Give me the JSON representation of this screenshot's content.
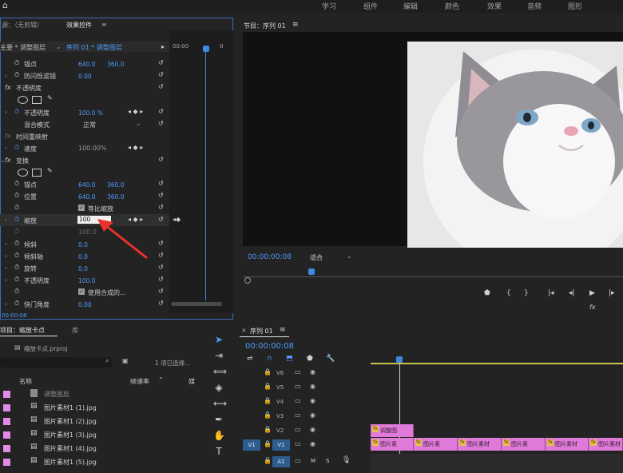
{
  "menu": {
    "items": [
      "学习",
      "组件",
      "编辑",
      "颜色",
      "效果",
      "音频",
      "图形"
    ]
  },
  "effect_controls": {
    "tab_source": "源：（无剪辑）",
    "tab_effect": "效果控件",
    "tab_effect_menu": "≡",
    "master": "主要 * 调整图层",
    "clip": "序列 01 * 调整图层",
    "timecode_left": "00:00",
    "timecode_right": "0",
    "current_time": "00:00:08",
    "rows": {
      "anchor_label": "锚点",
      "anchor_x": "640.0",
      "anchor_y": "360.0",
      "flicker_label": "防闪烁滤镜",
      "flicker_val": "0.00",
      "opacity_section": "不透明度",
      "opacity_label": "不透明度",
      "opacity_val": "100.0 %",
      "blend_label": "混合模式",
      "blend_val": "正常",
      "time_remap": "时间重映射",
      "speed_label": "速度",
      "speed_val": "100.00%",
      "transform_section": "变换",
      "t_anchor_label": "锚点",
      "t_anchor_x": "640.0",
      "t_anchor_y": "360.0",
      "pos_label": "位置",
      "pos_x": "640.0",
      "pos_y": "360.0",
      "uniform_label": "等比缩放",
      "scale_label": "缩放",
      "scale_val": "100",
      "scale_w_val": "100.0",
      "skew_label": "倾斜",
      "skew_val": "0.0",
      "skew_axis_label": "倾斜轴",
      "skew_axis_val": "0.0",
      "rot_label": "旋转",
      "rot_val": "0.0",
      "t_opacity_label": "不透明度",
      "t_opacity_val": "100.0",
      "composite_label": "使用合成的...",
      "shutter_label": "快门角度",
      "shutter_val": "0.00"
    }
  },
  "program": {
    "title": "节目：序列 01",
    "menu": "≡",
    "timecode": "00:00:00:08",
    "fit": "适合"
  },
  "project": {
    "tab": "项目：缩放卡点",
    "tab2": "库",
    "file": "缩放卡点.prproj",
    "selected": "1 项已选择...",
    "col_name": "名称",
    "col_rate": "帧速率",
    "col_extra": "媒",
    "items": [
      "调整图层",
      "图片素材1 (1).jpg",
      "图片素材1 (2).jpg",
      "图片素材1 (3).jpg",
      "图片素材1 (4).jpg",
      "图片素材1 (5).jpg"
    ]
  },
  "timeline": {
    "title": "序列 01",
    "menu": "≡",
    "timecode": "00:00:00:08",
    "tracks": [
      "V6",
      "V5",
      "V4",
      "V3",
      "V2",
      "V1",
      "A1"
    ],
    "src_v1": "V1",
    "adj_clip": "调整图",
    "clips": [
      "图片素",
      "图片素",
      "图片素材",
      "图片素",
      "图片素材",
      "图片素材",
      "图片"
    ],
    "audio_m": "M",
    "audio_s": "S"
  },
  "colors": {
    "accent": "#3b6cb8",
    "value_blue": "#4f9bff",
    "clip_pink": "#e07ad9",
    "label_magenta": "#e38ae6"
  }
}
